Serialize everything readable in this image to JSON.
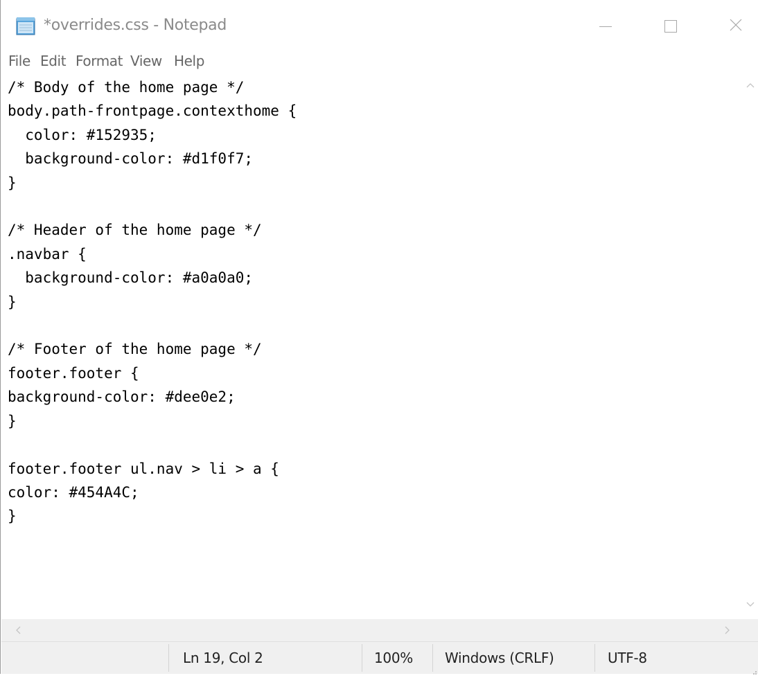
{
  "window": {
    "title": "*overrides.css - Notepad",
    "icon": "notepad-icon"
  },
  "controls": {
    "minimize_icon": "minimize-icon",
    "maximize_icon": "maximize-icon",
    "close_icon": "close-icon"
  },
  "menu": {
    "items": [
      {
        "label": "File"
      },
      {
        "label": "Edit"
      },
      {
        "label": "Format"
      },
      {
        "label": "View"
      },
      {
        "label": "Help"
      }
    ]
  },
  "editor": {
    "content": "/* Body of the home page */\nbody.path-frontpage.contexthome {\n  color: #152935;\n  background-color: #d1f0f7;\n}\n\n/* Header of the home page */\n.navbar {\n  background-color: #a0a0a0;\n}\n\n/* Footer of the home page */\nfooter.footer {\nbackground-color: #dee0e2;\n}\n\nfooter.footer ul.nav > li > a {\ncolor: #454A4C;\n}"
  },
  "scrollbars": {
    "up_arrow": "^",
    "down_arrow": "v",
    "left_arrow": "<",
    "right_arrow": ">"
  },
  "status": {
    "position": "Ln 19, Col 2",
    "zoom": "100%",
    "line_ending": "Windows (CRLF)",
    "encoding": "UTF-8"
  },
  "colors": {
    "chrome": "#f0f0f0",
    "title_text": "#8a8a8a",
    "menu_text": "#666666"
  }
}
